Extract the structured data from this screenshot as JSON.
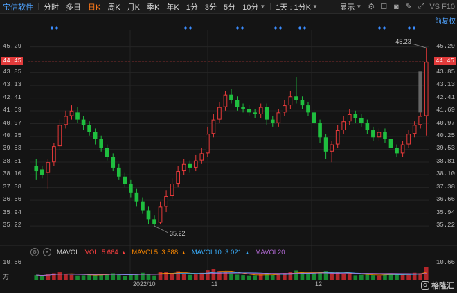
{
  "toolbar": {
    "stock_name": "宝信软件",
    "periods": [
      "分时",
      "多日",
      "日K",
      "周K",
      "月K",
      "季K",
      "年K",
      "1分",
      "3分",
      "5分"
    ],
    "active_period": "日K",
    "min_dropdown": "10分",
    "restore_dropdown": "1天 : 1分K",
    "display_dropdown": "显示",
    "brand": "VS F10"
  },
  "chart": {
    "restore_label": "前复权",
    "current_price": "44.45",
    "high_label": "45.23",
    "low_label": "35.22",
    "right_axis": [
      "45.29",
      "44.45",
      "43.85",
      "43.13",
      "42.41",
      "41.69",
      "40.97",
      "40.25",
      "39.53",
      "38.81",
      "38.10",
      "37.38",
      "36.66",
      "35.94",
      "35.22"
    ],
    "left_axis": [
      "45.29",
      "44.45",
      "43.85",
      "43.13",
      "42.41",
      "41.69",
      "40.97",
      "40.25",
      "39.53",
      "38.81",
      "38.10",
      "37.38",
      "36.66",
      "35.94",
      "35.22"
    ]
  },
  "volume": {
    "label": "MAVOL",
    "vol_label": "VOL:",
    "vol_value": "5.664",
    "mavol5_label": "MAVOL5:",
    "mavol5_value": "3.588",
    "mavol10_label": "MAVOL10:",
    "mavol10_value": "3.021",
    "mavol20_label": "MAVOL20",
    "axis_top": "10.66",
    "axis_unit": "万"
  },
  "dates": [
    "2022/10",
    "11",
    "12"
  ],
  "watermark": "格隆汇",
  "colors": {
    "up": "#e83a3a",
    "down": "#1fbf3f",
    "accent": "#ff7a1a",
    "link": "#4fa3ff",
    "mavol5": "#ff8a00",
    "mavol10": "#3ab0ff",
    "mavol20": "#b36bd6"
  },
  "chart_data": {
    "type": "candlestick",
    "title": "",
    "ylim": [
      34.6,
      45.9
    ],
    "candles": [
      {
        "o": 38.6,
        "c": 38.3,
        "h": 39.0,
        "l": 37.8
      },
      {
        "o": 38.4,
        "c": 38.1,
        "h": 38.6,
        "l": 37.9
      },
      {
        "o": 38.2,
        "c": 38.8,
        "h": 39.0,
        "l": 37.3
      },
      {
        "o": 38.8,
        "c": 39.7,
        "h": 39.9,
        "l": 38.6
      },
      {
        "o": 39.7,
        "c": 40.9,
        "h": 41.2,
        "l": 39.5
      },
      {
        "o": 40.9,
        "c": 41.4,
        "h": 41.7,
        "l": 40.7
      },
      {
        "o": 41.4,
        "c": 41.7,
        "h": 42.0,
        "l": 41.2
      },
      {
        "o": 41.6,
        "c": 41.2,
        "h": 41.9,
        "l": 41.0
      },
      {
        "o": 41.2,
        "c": 40.9,
        "h": 41.4,
        "l": 40.6
      },
      {
        "o": 40.9,
        "c": 40.5,
        "h": 41.1,
        "l": 40.3
      },
      {
        "o": 40.5,
        "c": 40.1,
        "h": 40.7,
        "l": 39.8
      },
      {
        "o": 40.1,
        "c": 39.6,
        "h": 40.3,
        "l": 39.4
      },
      {
        "o": 39.6,
        "c": 39.1,
        "h": 39.8,
        "l": 38.9
      },
      {
        "o": 39.1,
        "c": 38.5,
        "h": 39.3,
        "l": 38.3
      },
      {
        "o": 38.5,
        "c": 38.0,
        "h": 38.7,
        "l": 37.8
      },
      {
        "o": 38.0,
        "c": 37.6,
        "h": 38.2,
        "l": 37.4
      },
      {
        "o": 37.6,
        "c": 37.1,
        "h": 37.8,
        "l": 36.8
      },
      {
        "o": 37.1,
        "c": 36.6,
        "h": 37.3,
        "l": 36.3
      },
      {
        "o": 36.6,
        "c": 36.1,
        "h": 36.8,
        "l": 35.9
      },
      {
        "o": 36.1,
        "c": 35.6,
        "h": 36.3,
        "l": 35.3
      },
      {
        "o": 35.6,
        "c": 35.3,
        "h": 35.8,
        "l": 35.22
      },
      {
        "o": 35.4,
        "c": 36.3,
        "h": 36.6,
        "l": 35.3
      },
      {
        "o": 36.3,
        "c": 36.9,
        "h": 37.2,
        "l": 36.0
      },
      {
        "o": 36.9,
        "c": 37.6,
        "h": 37.9,
        "l": 36.7
      },
      {
        "o": 37.6,
        "c": 38.3,
        "h": 38.6,
        "l": 37.4
      },
      {
        "o": 38.3,
        "c": 38.7,
        "h": 39.0,
        "l": 38.1
      },
      {
        "o": 38.7,
        "c": 38.5,
        "h": 38.9,
        "l": 38.2
      },
      {
        "o": 38.5,
        "c": 38.9,
        "h": 39.2,
        "l": 38.3
      },
      {
        "o": 38.9,
        "c": 39.3,
        "h": 39.6,
        "l": 38.7
      },
      {
        "o": 39.3,
        "c": 40.4,
        "h": 40.8,
        "l": 39.1
      },
      {
        "o": 40.4,
        "c": 41.2,
        "h": 41.5,
        "l": 40.2
      },
      {
        "o": 41.2,
        "c": 41.9,
        "h": 42.2,
        "l": 41.0
      },
      {
        "o": 41.9,
        "c": 42.6,
        "h": 42.8,
        "l": 41.7
      },
      {
        "o": 42.6,
        "c": 42.3,
        "h": 42.9,
        "l": 42.1
      },
      {
        "o": 42.3,
        "c": 41.9,
        "h": 42.5,
        "l": 41.7
      },
      {
        "o": 41.9,
        "c": 41.8,
        "h": 42.1,
        "l": 41.6
      },
      {
        "o": 41.8,
        "c": 41.6,
        "h": 42.0,
        "l": 41.4
      },
      {
        "o": 41.6,
        "c": 41.5,
        "h": 41.8,
        "l": 41.3
      },
      {
        "o": 41.5,
        "c": 41.9,
        "h": 42.1,
        "l": 41.3
      },
      {
        "o": 41.9,
        "c": 41.2,
        "h": 42.1,
        "l": 40.9
      },
      {
        "o": 41.2,
        "c": 41.0,
        "h": 41.4,
        "l": 40.8
      },
      {
        "o": 41.0,
        "c": 41.6,
        "h": 41.8,
        "l": 40.8
      },
      {
        "o": 41.6,
        "c": 42.0,
        "h": 42.3,
        "l": 41.4
      },
      {
        "o": 42.0,
        "c": 42.5,
        "h": 42.8,
        "l": 41.8
      },
      {
        "o": 42.5,
        "c": 42.3,
        "h": 43.6,
        "l": 42.1
      },
      {
        "o": 42.3,
        "c": 42.0,
        "h": 42.5,
        "l": 41.8
      },
      {
        "o": 42.0,
        "c": 41.6,
        "h": 42.2,
        "l": 41.4
      },
      {
        "o": 41.6,
        "c": 41.0,
        "h": 41.8,
        "l": 40.8
      },
      {
        "o": 41.0,
        "c": 40.2,
        "h": 41.2,
        "l": 39.9
      },
      {
        "o": 40.2,
        "c": 39.4,
        "h": 40.4,
        "l": 39.0
      },
      {
        "o": 39.4,
        "c": 39.8,
        "h": 40.0,
        "l": 38.8
      },
      {
        "o": 39.8,
        "c": 40.6,
        "h": 40.9,
        "l": 39.6
      },
      {
        "o": 40.6,
        "c": 41.1,
        "h": 41.4,
        "l": 40.4
      },
      {
        "o": 41.1,
        "c": 41.5,
        "h": 41.8,
        "l": 40.9
      },
      {
        "o": 41.5,
        "c": 41.3,
        "h": 41.7,
        "l": 41.0
      },
      {
        "o": 41.3,
        "c": 41.0,
        "h": 41.5,
        "l": 40.8
      },
      {
        "o": 41.0,
        "c": 40.6,
        "h": 41.2,
        "l": 40.4
      },
      {
        "o": 40.6,
        "c": 40.2,
        "h": 40.8,
        "l": 40.0
      },
      {
        "o": 40.2,
        "c": 40.5,
        "h": 40.7,
        "l": 40.0
      },
      {
        "o": 40.5,
        "c": 40.1,
        "h": 40.7,
        "l": 39.9
      },
      {
        "o": 40.1,
        "c": 39.6,
        "h": 40.3,
        "l": 39.4
      },
      {
        "o": 39.6,
        "c": 39.3,
        "h": 39.8,
        "l": 39.1
      },
      {
        "o": 39.3,
        "c": 39.8,
        "h": 40.0,
        "l": 39.1
      },
      {
        "o": 39.8,
        "c": 40.4,
        "h": 40.6,
        "l": 39.6
      },
      {
        "o": 40.4,
        "c": 40.9,
        "h": 41.1,
        "l": 40.2
      },
      {
        "o": 40.9,
        "c": 41.4,
        "h": 41.6,
        "l": 40.7
      },
      {
        "o": 41.4,
        "c": 44.45,
        "h": 45.23,
        "l": 40.3
      }
    ],
    "volumes": [
      2.1,
      1.8,
      2.4,
      2.9,
      3.3,
      2.6,
      2.2,
      1.9,
      2.0,
      2.3,
      2.1,
      2.6,
      2.4,
      2.9,
      2.2,
      1.8,
      2.3,
      2.7,
      3.1,
      2.5,
      1.9,
      3.6,
      3.4,
      2.9,
      3.8,
      2.6,
      2.2,
      2.4,
      3.1,
      4.2,
      4.6,
      3.9,
      3.5,
      2.8,
      2.3,
      2.1,
      1.9,
      2.0,
      2.4,
      2.6,
      2.2,
      2.5,
      3.0,
      3.4,
      4.1,
      3.2,
      2.7,
      3.0,
      3.6,
      3.9,
      2.8,
      3.2,
      2.9,
      2.4,
      2.0,
      2.2,
      2.5,
      2.1,
      1.9,
      2.3,
      2.6,
      2.4,
      2.2,
      2.8,
      3.1,
      2.9,
      5.664
    ],
    "vol_ylim": [
      0,
      10.66
    ]
  }
}
